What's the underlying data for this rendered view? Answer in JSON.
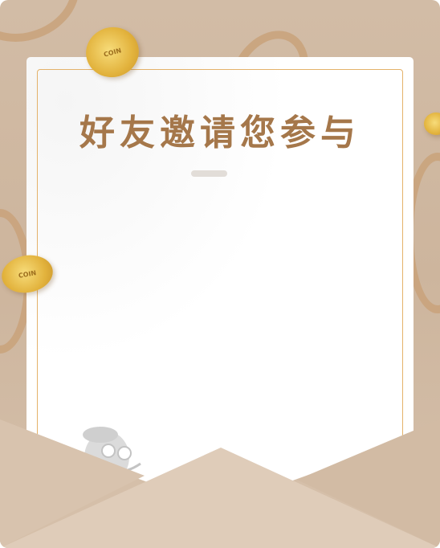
{
  "invite": {
    "title": "好友邀请您参与",
    "coin_label": "COIN"
  },
  "colors": {
    "background": "#cdb59d",
    "title": "#a5774a",
    "border": "#e4b26a",
    "envelope": "#dcc8b4"
  }
}
